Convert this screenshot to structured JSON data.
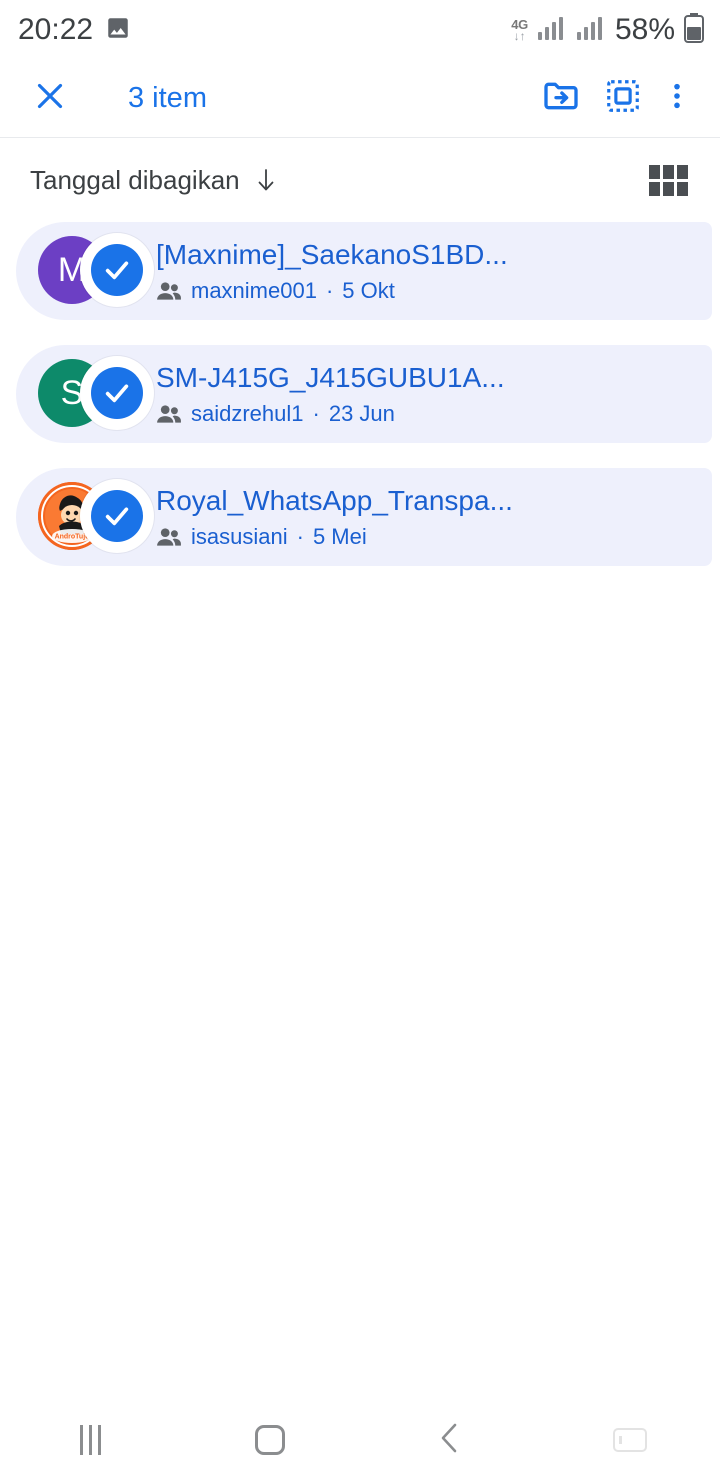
{
  "status_bar": {
    "time": "20:22",
    "image_icon": "image-icon",
    "network_type": "4G",
    "data_arrows": "↓↑",
    "signal_bars_1": "signal-bars-icon",
    "signal_bars_2": "signal-bars-icon",
    "battery_percent": "58%",
    "battery_icon": "battery-icon"
  },
  "app_bar": {
    "close_icon": "close-icon",
    "title": "3 item",
    "actions": [
      {
        "name": "move-to-folder-icon"
      },
      {
        "name": "select-all-icon"
      },
      {
        "name": "more-options-icon"
      }
    ]
  },
  "sort_row": {
    "label": "Tanggal dibagikan",
    "direction_icon": "arrow-down-icon",
    "grid_view_icon": "grid-view-icon"
  },
  "files": [
    {
      "title": "[Maxnime]_SaekanoS1BD...",
      "owner": "maxnime001",
      "separator": "·",
      "date": "5 Okt",
      "avatar_letter": "M",
      "avatar_color": "#6c3fc4",
      "avatar_type": "letter",
      "selected": true,
      "shared_icon": "people-icon",
      "check_icon": "check-icon"
    },
    {
      "title": "SM-J415G_J415GUBU1A...",
      "owner": "saidzrehul1",
      "separator": "·",
      "date": "23 Jun",
      "avatar_letter": "S",
      "avatar_color": "#0d8a6a",
      "avatar_type": "letter",
      "selected": true,
      "shared_icon": "people-icon",
      "check_icon": "check-icon"
    },
    {
      "title": "Royal_WhatsApp_Transpa...",
      "owner": "isasusiani",
      "separator": "·",
      "date": "5 Mei",
      "avatar_letter": "",
      "avatar_color": "#f05a1e",
      "avatar_type": "photo",
      "selected": true,
      "shared_icon": "people-icon",
      "check_icon": "check-icon"
    }
  ],
  "nav_bar": {
    "recents": "recents-icon",
    "home": "home-icon",
    "back": "back-icon",
    "keyboard": "keyboard-icon"
  },
  "colors": {
    "accent": "#1a73e8",
    "row_background": "#eef0fc",
    "title_text": "#1a5fd0",
    "status_text": "#3c4043"
  }
}
